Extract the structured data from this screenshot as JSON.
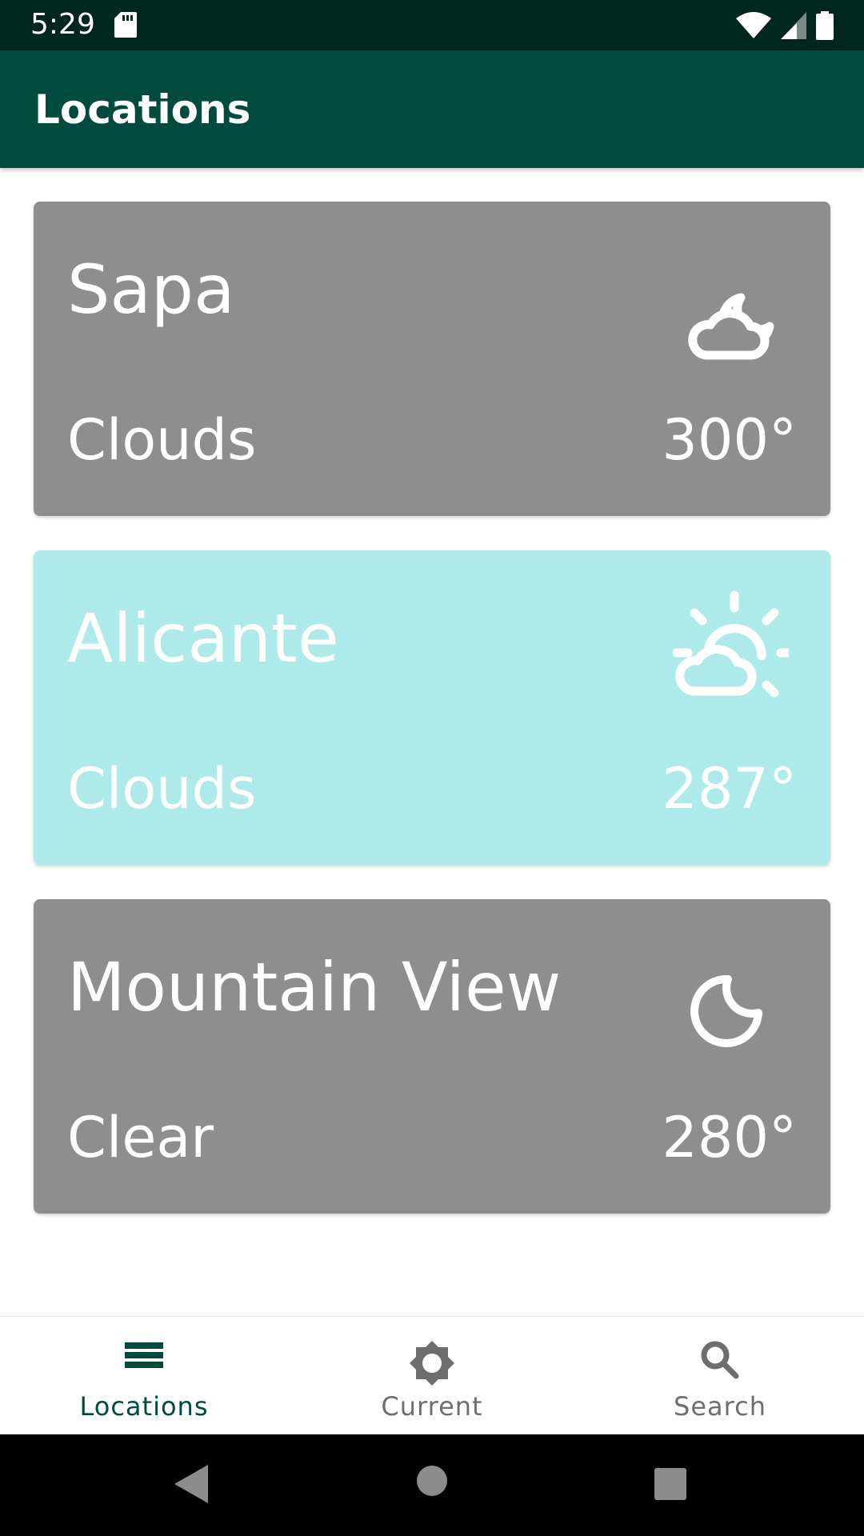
{
  "status_bar": {
    "time": "5:29",
    "icons": [
      "sd-card-icon",
      "wifi-icon",
      "cell-signal-icon",
      "battery-icon"
    ]
  },
  "app_bar": {
    "title": "Locations"
  },
  "locations": [
    {
      "name": "Sapa",
      "condition": "Clouds",
      "temperature": "300°",
      "icon": "cloud-moon-icon",
      "color": "#8e8e8e"
    },
    {
      "name": "Alicante",
      "condition": "Clouds",
      "temperature": "287°",
      "icon": "cloud-sun-icon",
      "color": "#aeeaea"
    },
    {
      "name": "Mountain View",
      "condition": "Clear",
      "temperature": "280°",
      "icon": "moon-icon",
      "color": "#8e8e8e"
    }
  ],
  "bottom_nav": {
    "items": [
      {
        "label": "Locations",
        "icon": "list-icon",
        "active": true
      },
      {
        "label": "Current",
        "icon": "sun-icon",
        "active": false
      },
      {
        "label": "Search",
        "icon": "search-icon",
        "active": false
      }
    ]
  },
  "colors": {
    "status_bar": "#00261d",
    "app_bar": "#004b3e",
    "active_tab": "#004b3e",
    "inactive_tab": "#6e6e6e"
  }
}
